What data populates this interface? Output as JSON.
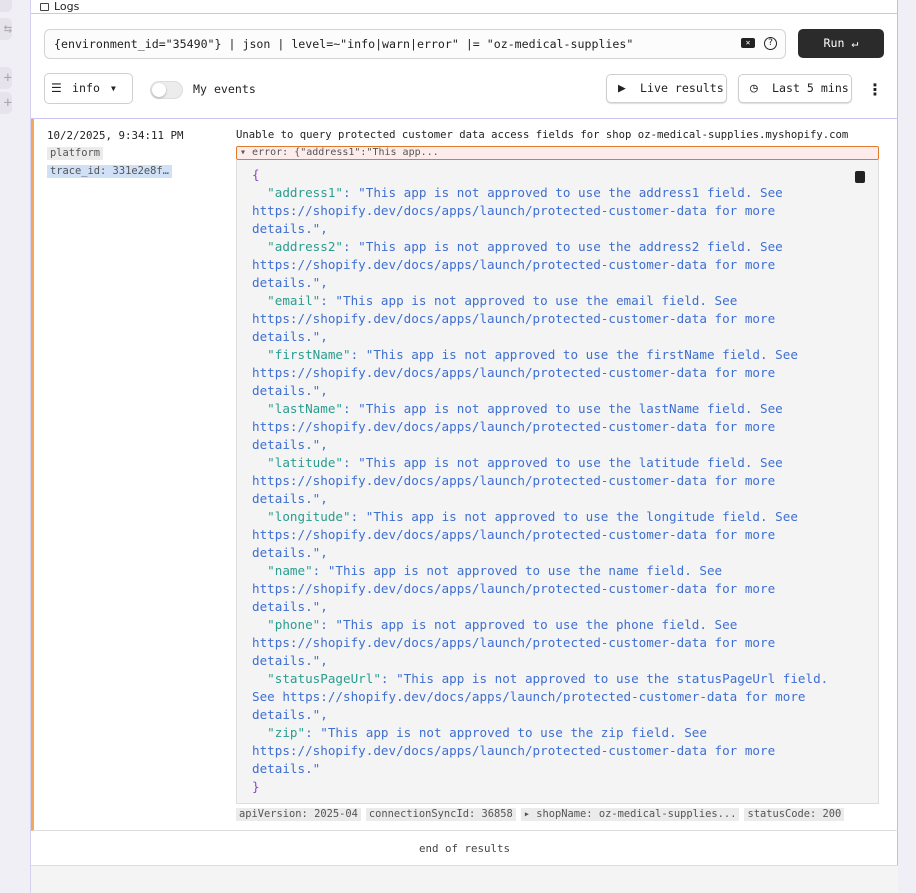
{
  "header": {
    "title": "Logs"
  },
  "query": {
    "value": "{environment_id=\"35490\"} | json | level=~\"info|warn|error\" |= \"oz-medical-supplies\"",
    "run_label": "Run ↵"
  },
  "controls": {
    "level": "info",
    "my_events_label": "My events",
    "my_events_on": false,
    "live_label": "Live results",
    "time_label": "Last 5 mins"
  },
  "entry": {
    "timestamp": "10/2/2025, 9:34:11 PM",
    "source_tag": "platform",
    "trace_tag": "trace_id: 331e2e8f…",
    "message": "Unable to query protected customer data access fields for shop oz-medical-supplies.myshopify.com",
    "error_summary": "error: {\"address1\":\"This app...",
    "error_fields": [
      {
        "key": "address1",
        "value": "This app is not approved to use the address1 field. See https://shopify.dev/docs/apps/launch/protected-customer-data for more details."
      },
      {
        "key": "address2",
        "value": "This app is not approved to use the address2 field. See https://shopify.dev/docs/apps/launch/protected-customer-data for more details."
      },
      {
        "key": "email",
        "value": "This app is not approved to use the email field. See https://shopify.dev/docs/apps/launch/protected-customer-data for more details."
      },
      {
        "key": "firstName",
        "value": "This app is not approved to use the firstName field. See https://shopify.dev/docs/apps/launch/protected-customer-data for more details."
      },
      {
        "key": "lastName",
        "value": "This app is not approved to use the lastName field. See https://shopify.dev/docs/apps/launch/protected-customer-data for more details."
      },
      {
        "key": "latitude",
        "value": "This app is not approved to use the latitude field. See https://shopify.dev/docs/apps/launch/protected-customer-data for more details."
      },
      {
        "key": "longitude",
        "value": "This app is not approved to use the longitude field. See https://shopify.dev/docs/apps/launch/protected-customer-data for more details."
      },
      {
        "key": "name",
        "value": "This app is not approved to use the name field. See https://shopify.dev/docs/apps/launch/protected-customer-data for more details."
      },
      {
        "key": "phone",
        "value": "This app is not approved to use the phone field. See https://shopify.dev/docs/apps/launch/protected-customer-data for more details."
      },
      {
        "key": "statusPageUrl",
        "value": "This app is not approved to use the statusPageUrl field. See https://shopify.dev/docs/apps/launch/protected-customer-data for more details."
      },
      {
        "key": "zip",
        "value": "This app is not approved to use the zip field. See https://shopify.dev/docs/apps/launch/protected-customer-data for more details."
      }
    ],
    "fields": [
      "apiVersion: 2025-04",
      "connectionSyncId: 36858",
      "▸ shopName: oz-medical-supplies...",
      "statusCode: 200"
    ]
  },
  "end_label": "end of results",
  "colors": {
    "accent": "#f5a65b",
    "error_border": "#e07b2c",
    "json_key": "#2a9d8f",
    "json_string": "#3f6fd1",
    "run_bg": "#2b2b2b"
  }
}
